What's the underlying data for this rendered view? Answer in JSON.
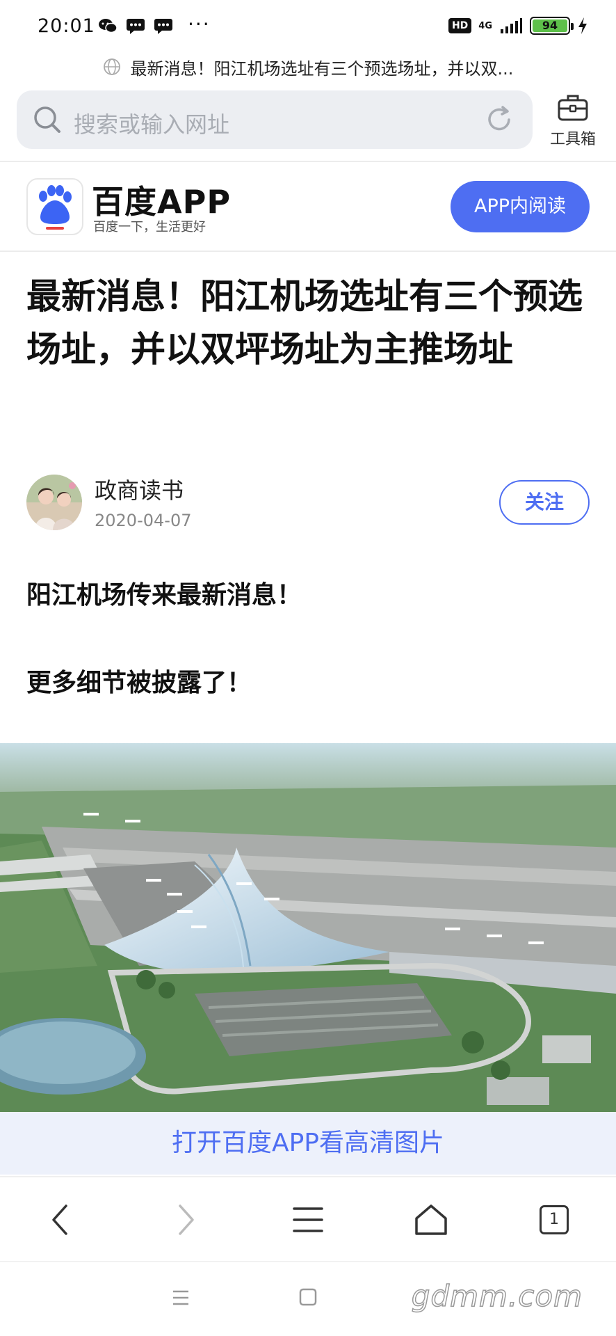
{
  "status_bar": {
    "time": "20:01",
    "dots": "···",
    "hd": "HD",
    "network": "4G",
    "battery": "94"
  },
  "url_bar": {
    "page_title": "最新消息！阳江机场选址有三个预选场址，并以双..."
  },
  "search": {
    "placeholder": "搜索或输入网址"
  },
  "toolbox": {
    "label": "工具箱"
  },
  "banner": {
    "brand": "百度APP",
    "slogan": "百度一下，生活更好",
    "logo_text": "du",
    "open_button": "APP内阅读"
  },
  "article": {
    "title": "最新消息！阳江机场选址有三个预选场址，并以双坪场址为主推场址",
    "author": "政商读书",
    "date": "2020-04-07",
    "follow_label": "关注",
    "paragraphs": [
      "阳江机场传来最新消息！",
      "更多细节被披露了！"
    ]
  },
  "hd_banner": {
    "label": "打开百度APP看高清图片"
  },
  "browser_toolbar": {
    "tabs_count": "1"
  },
  "watermark": "gdmm.com",
  "colors": {
    "accent": "#4e6ef2",
    "search_bg": "#eceef2",
    "hd_banner_bg": "#edf1fb"
  }
}
